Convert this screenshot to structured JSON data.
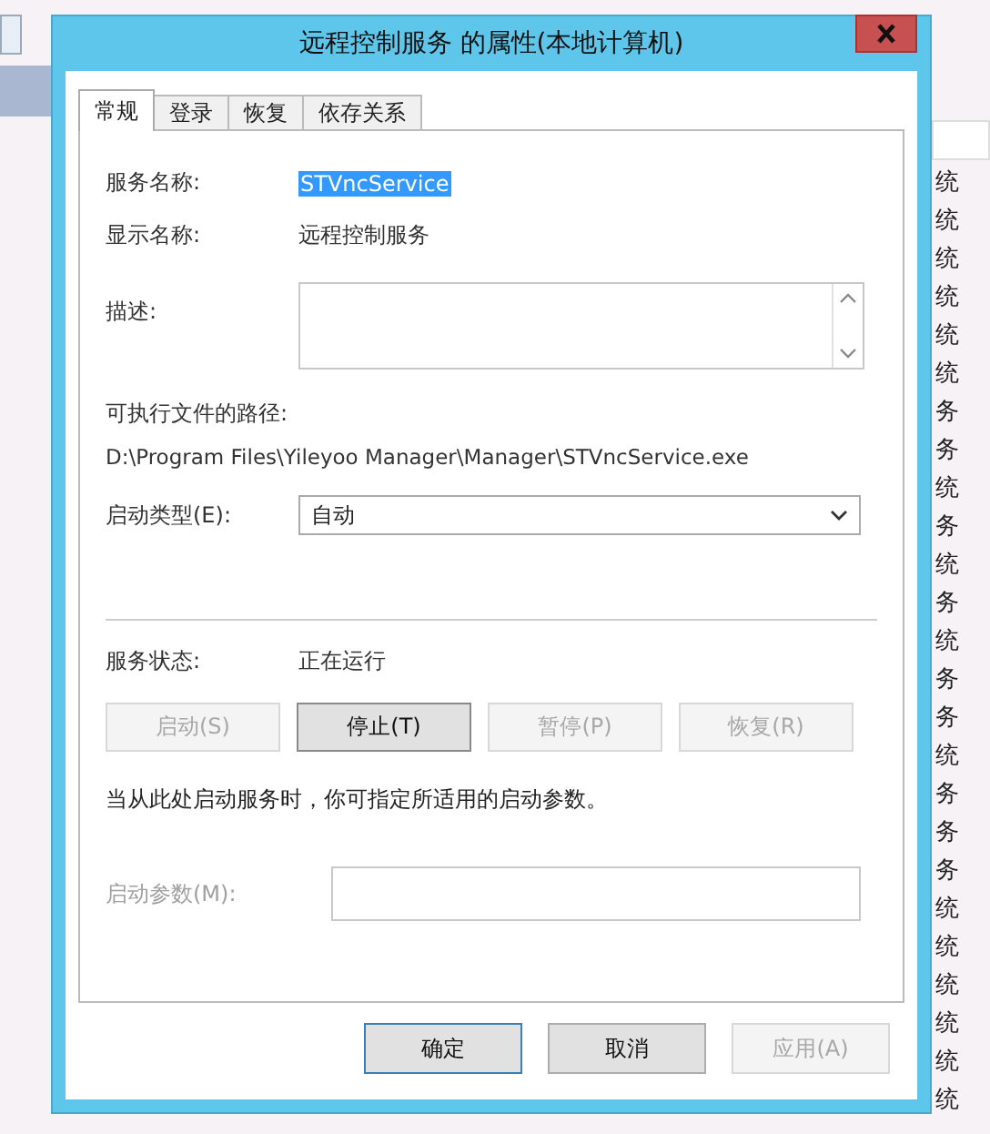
{
  "window": {
    "title": "远程控制服务 的属性(本地计算机)"
  },
  "tabs": [
    {
      "label": "常规",
      "selected": true
    },
    {
      "label": "登录",
      "selected": false
    },
    {
      "label": "恢复",
      "selected": false
    },
    {
      "label": "依存关系",
      "selected": false
    }
  ],
  "service_name": {
    "label": "服务名称:",
    "value": "STVncService",
    "selected": true
  },
  "display_name": {
    "label": "显示名称:",
    "value": "远程控制服务"
  },
  "description": {
    "label": "描述:"
  },
  "executable_path": {
    "label": "可执行文件的路径:",
    "value": "D:\\Program Files\\Yileyoo Manager\\Manager\\STVncService.exe"
  },
  "startup_type": {
    "label": "启动类型(E):",
    "value": "自动"
  },
  "service_status": {
    "label": "服务状态:",
    "value": "正在运行"
  },
  "service_buttons": [
    {
      "label": "启动(S)",
      "disabled": true
    },
    {
      "label": "停止(T)",
      "disabled": false
    },
    {
      "label": "暂停(P)",
      "disabled": true
    },
    {
      "label": "恢复(R)",
      "disabled": true
    }
  ],
  "hint": "当从此处启动服务时，你可指定所适用的启动参数。",
  "start_parameters": {
    "label": "启动参数(M):",
    "disabled": true
  },
  "buttons": [
    {
      "label": "确定",
      "disabled": false,
      "default": true
    },
    {
      "label": "取消",
      "disabled": false,
      "default": false
    },
    {
      "label": "应用(A)",
      "disabled": true,
      "default": false
    }
  ],
  "background_list": {
    "rows": [
      "统",
      "统",
      "统",
      "统",
      "统",
      "统",
      "务",
      "务",
      "统",
      "务",
      "统",
      "务",
      "统",
      "务",
      "务",
      "统",
      "务",
      "务",
      "务",
      "统",
      "统",
      "统",
      "统",
      "统",
      "统"
    ]
  }
}
